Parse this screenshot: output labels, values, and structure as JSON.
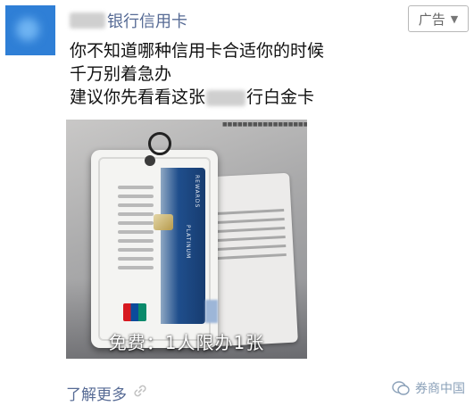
{
  "header": {
    "account_name": "银行信用卡",
    "ad_badge": "广告"
  },
  "message": {
    "lines": [
      "你不知道哪种信用卡合适你的时候",
      "千万别着急办",
      "建议你先看看这张"
    ],
    "line3_suffix": "行白金卡"
  },
  "ad_image": {
    "card_vertical_text_1": "REWARDS",
    "card_vertical_text_2": "PLATINUM",
    "caption": "免费：1人限办1张"
  },
  "footer": {
    "learn_more": "了解更多",
    "watermark": "券商中国"
  },
  "colors": {
    "link": "#576b95",
    "card_blue": "#1f4e8c"
  }
}
